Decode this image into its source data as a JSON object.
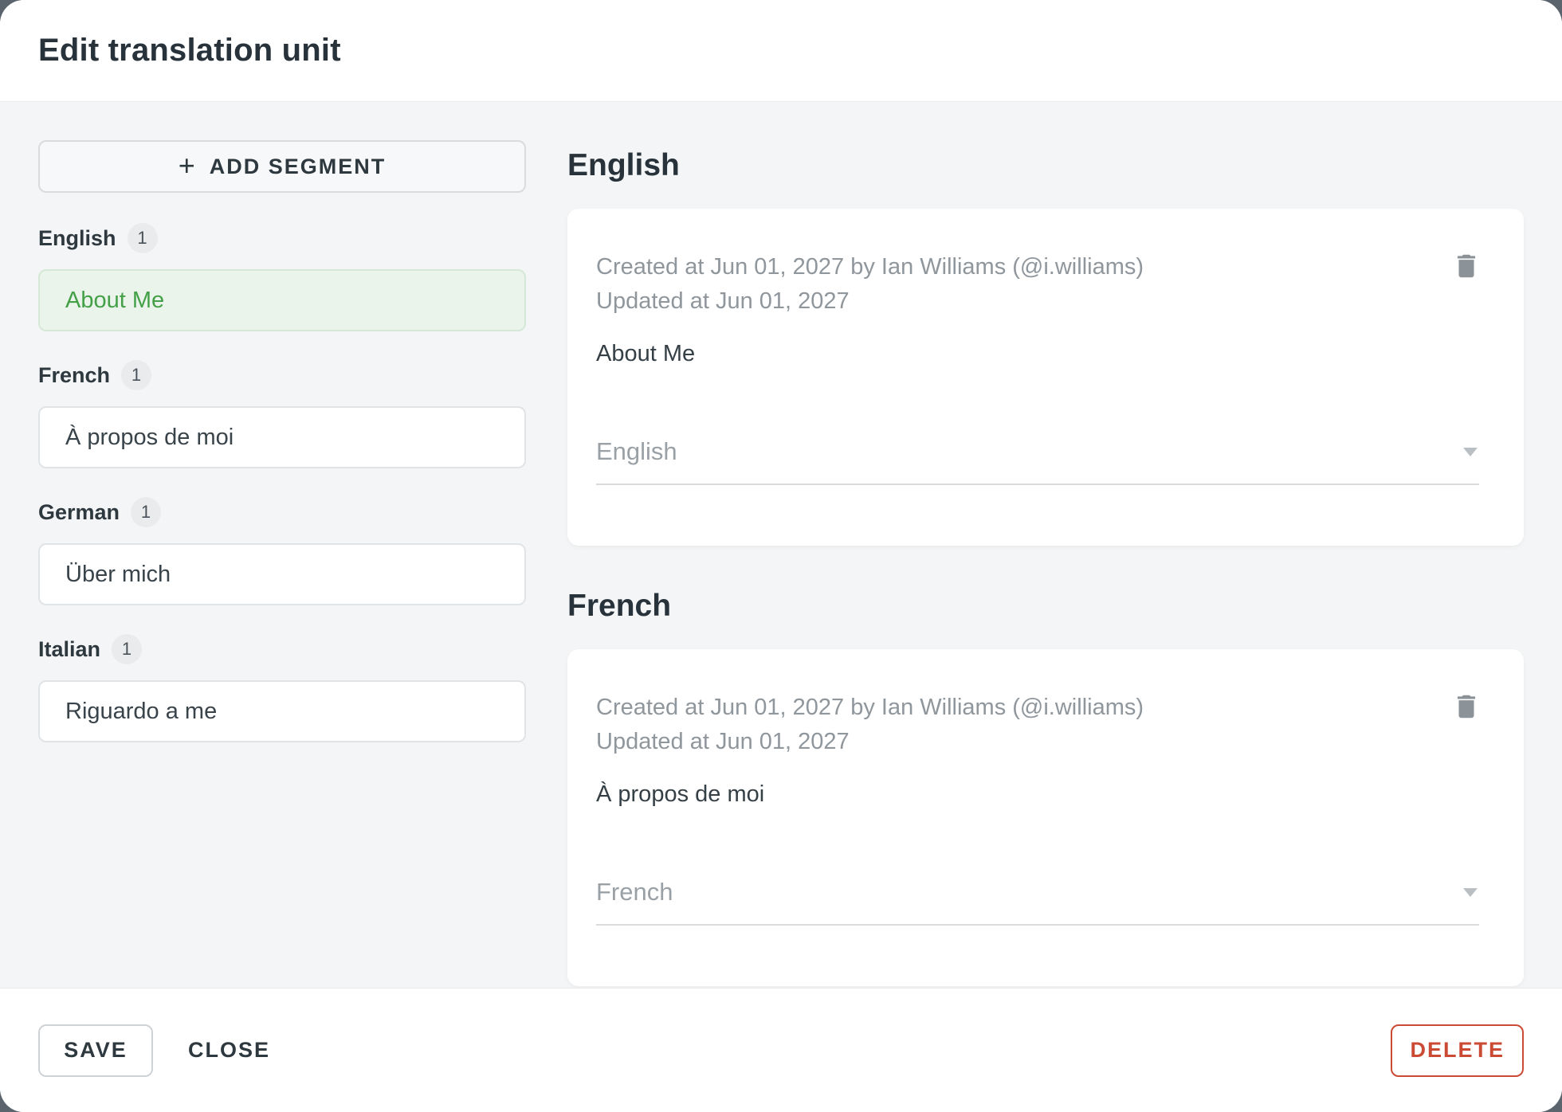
{
  "dialog": {
    "title": "Edit translation unit"
  },
  "icons": {
    "plus": "+"
  },
  "sidebar": {
    "add_segment_label": "ADD SEGMENT",
    "groups": [
      {
        "language": "English",
        "count": "1",
        "items": [
          {
            "text": "About Me",
            "selected": true
          }
        ]
      },
      {
        "language": "French",
        "count": "1",
        "items": [
          {
            "text": "À propos de moi",
            "selected": false
          }
        ]
      },
      {
        "language": "German",
        "count": "1",
        "items": [
          {
            "text": "Über mich",
            "selected": false
          }
        ]
      },
      {
        "language": "Italian",
        "count": "1",
        "items": [
          {
            "text": "Riguardo a me",
            "selected": false
          }
        ]
      }
    ]
  },
  "main": {
    "sections": [
      {
        "heading": "English",
        "created": "Created at Jun 01, 2027 by Ian Williams (@i.williams)",
        "updated": "Updated at Jun 01, 2027",
        "text": "About Me",
        "selected_language": "English"
      },
      {
        "heading": "French",
        "created": "Created at Jun 01, 2027 by Ian Williams (@i.williams)",
        "updated": "Updated at Jun 01, 2027",
        "text": "À propos de moi",
        "selected_language": "French"
      }
    ]
  },
  "footer": {
    "save_label": "SAVE",
    "close_label": "CLOSE",
    "delete_label": "DELETE"
  },
  "colors": {
    "accent_green": "#43a047",
    "selected_item_bg": "#eaf4eb",
    "danger_red": "#cb4a33",
    "body_bg": "#f4f5f6",
    "backdrop": "#5b646d"
  }
}
